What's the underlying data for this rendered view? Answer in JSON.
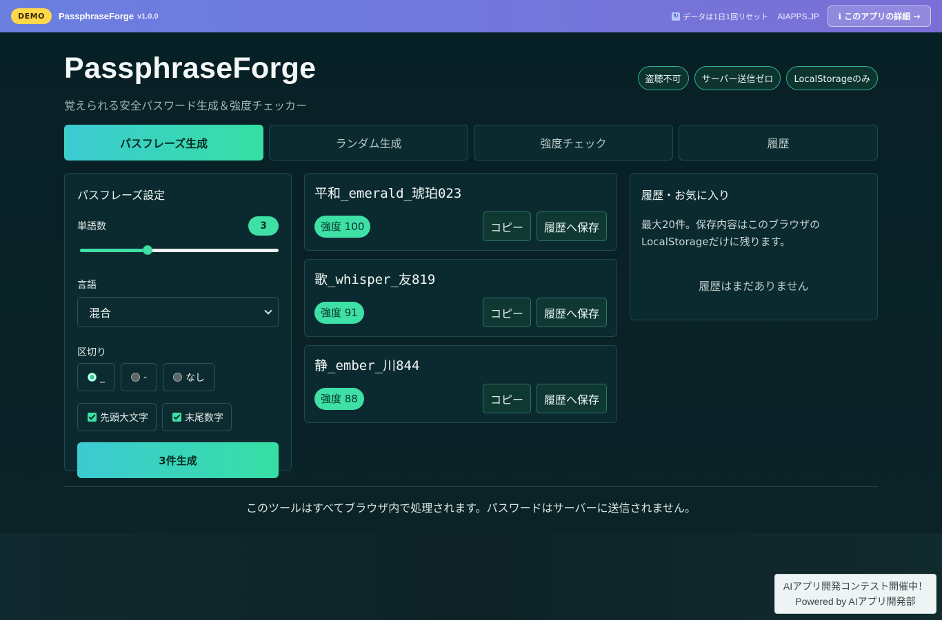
{
  "topbar": {
    "demo_label": "DEMO",
    "app_name": "PassphraseForge",
    "version": "v1.0.0",
    "reset_note": "データは1日1回リセット",
    "site_link": "AIAPPS.JP",
    "details_button": "ℹ このアプリの詳細 →"
  },
  "header": {
    "title": "PassphraseForge",
    "subtitle": "覚えられる安全パスワード生成＆強度チェッカー",
    "chips": [
      "盗聴不可",
      "サーバー送信ゼロ",
      "LocalStorageのみ"
    ]
  },
  "tabs": [
    {
      "label": "パスフレーズ生成",
      "active": true
    },
    {
      "label": "ランダム生成",
      "active": false
    },
    {
      "label": "強度チェック",
      "active": false
    },
    {
      "label": "履歴",
      "active": false
    }
  ],
  "settings": {
    "title": "パスフレーズ設定",
    "word_count_label": "単語数",
    "word_count": "3",
    "word_count_fraction": 0.34,
    "language_label": "言語",
    "language_value": "混合",
    "separator_label": "区切り",
    "separators": [
      {
        "label": "_",
        "selected": true
      },
      {
        "label": "-",
        "selected": false
      },
      {
        "label": "なし",
        "selected": false
      }
    ],
    "options": [
      {
        "label": "先頭大文字",
        "checked": true
      },
      {
        "label": "末尾数字",
        "checked": true
      }
    ],
    "generate_button": "3件生成"
  },
  "results": [
    {
      "phrase": "平和_emerald_琥珀023",
      "strength": "強度 100"
    },
    {
      "phrase": "歌_whisper_友819",
      "strength": "強度 91"
    },
    {
      "phrase": "静_ember_川844",
      "strength": "強度 88"
    }
  ],
  "result_actions": {
    "copy": "コピー",
    "save": "履歴へ保存"
  },
  "history": {
    "title": "履歴・お気に入り",
    "description": "最大20件。保存内容はこのブラウザのLocalStorageだけに残ります。",
    "empty": "履歴はまだありません"
  },
  "footer": {
    "text": "このツールはすべてブラウザ内で処理されます。パスワードはサーバーに送信されません。"
  },
  "contest": {
    "line1": "AIアプリ開発コンテスト開催中！",
    "line2": "Powered by AIアプリ開発部"
  }
}
